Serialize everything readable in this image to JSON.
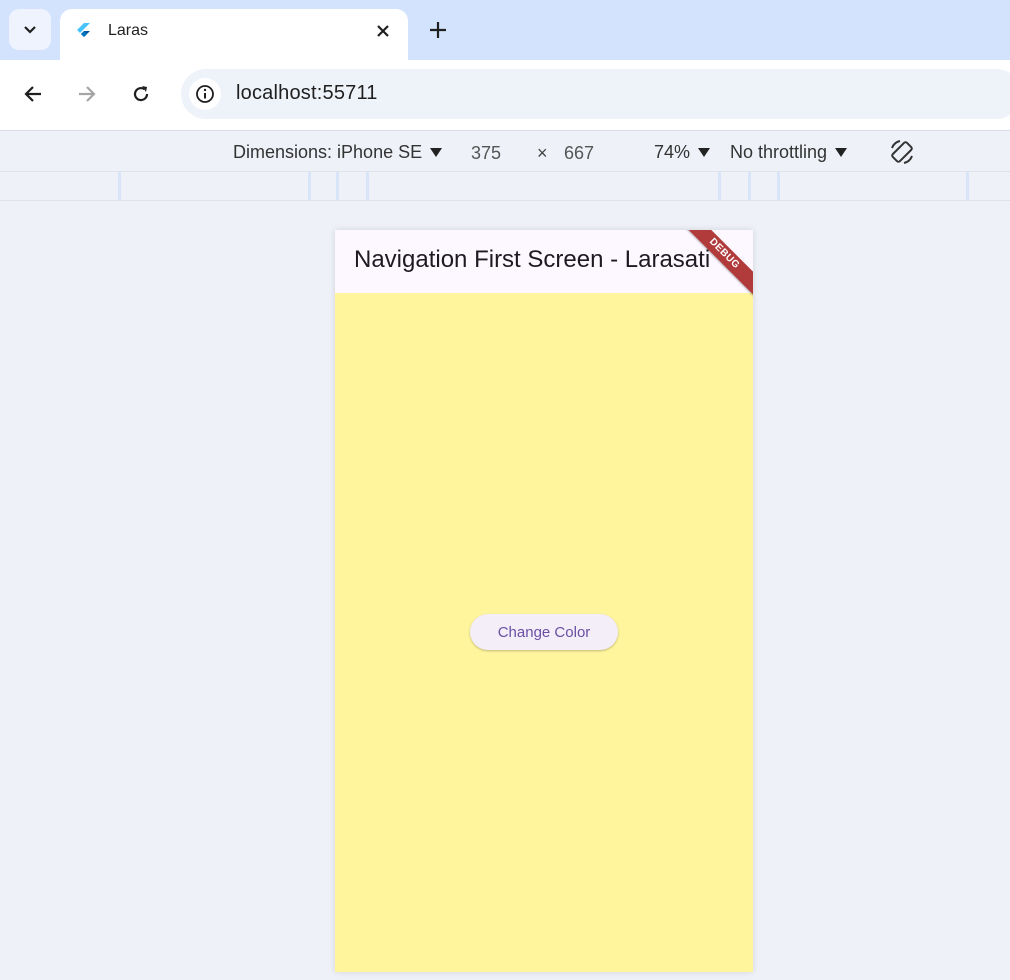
{
  "browser": {
    "tab": {
      "title": "Laras"
    },
    "address_bar": {
      "url": "localhost:55711"
    }
  },
  "device_toolbar": {
    "dimensions_label": "Dimensions: iPhone SE",
    "width": "375",
    "times": "×",
    "height": "667",
    "zoom": "74%",
    "throttling": "No throttling"
  },
  "app": {
    "appbar_title": "Navigation First Screen - Larasati",
    "debug_banner": "DEBUG",
    "button_label": "Change Color",
    "background_color": "#fff59d",
    "appbar_color": "#fdf7ff",
    "button_text_color": "#6a4fa3"
  }
}
